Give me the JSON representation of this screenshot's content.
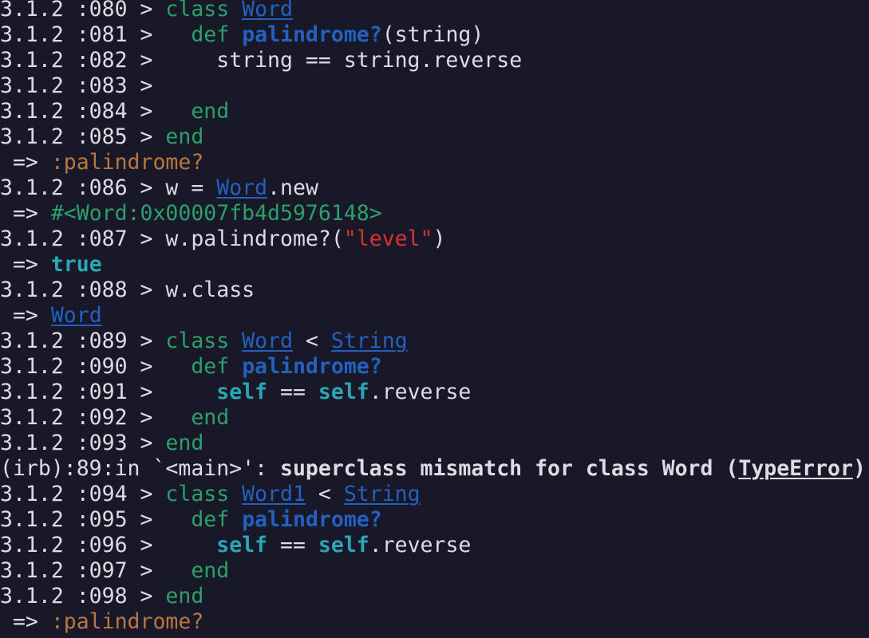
{
  "terminal": {
    "lines": [
      {
        "type": "input",
        "prompt": "3.1.2 :080 > ",
        "segs": [
          [
            "class",
            "kw"
          ],
          [
            " ",
            ""
          ],
          [
            "Word",
            "cn"
          ]
        ]
      },
      {
        "type": "input",
        "prompt": "3.1.2 :081 > ",
        "segs": [
          [
            "  ",
            ""
          ],
          [
            "def",
            "kw"
          ],
          [
            " ",
            ""
          ],
          [
            "palindrome?",
            "fn"
          ],
          [
            "(string)",
            ""
          ]
        ]
      },
      {
        "type": "input",
        "prompt": "3.1.2 :082 > ",
        "segs": [
          [
            "    string == string.reverse",
            ""
          ]
        ]
      },
      {
        "type": "input",
        "prompt": "3.1.2 :083 > ",
        "segs": []
      },
      {
        "type": "input",
        "prompt": "3.1.2 :084 > ",
        "segs": [
          [
            "  ",
            ""
          ],
          [
            "end",
            "kw"
          ]
        ]
      },
      {
        "type": "input",
        "prompt": "3.1.2 :085 > ",
        "segs": [
          [
            "end",
            "kw"
          ]
        ]
      },
      {
        "type": "output",
        "prompt": " => ",
        "segs": [
          [
            ":palindrome?",
            "sym"
          ]
        ]
      },
      {
        "type": "input",
        "prompt": "3.1.2 :086 > ",
        "segs": [
          [
            "w = ",
            ""
          ],
          [
            "Word",
            "cn"
          ],
          [
            ".new",
            ""
          ]
        ]
      },
      {
        "type": "output",
        "prompt": " => ",
        "segs": [
          [
            "#<Word:0x00007fb4d5976148>",
            "obj"
          ]
        ]
      },
      {
        "type": "input",
        "prompt": "3.1.2 :087 > ",
        "segs": [
          [
            "w.palindrome?(",
            ""
          ],
          [
            "\"level\"",
            "str"
          ],
          [
            ")",
            ""
          ]
        ]
      },
      {
        "type": "output",
        "prompt": " => ",
        "segs": [
          [
            "true",
            "tru"
          ]
        ]
      },
      {
        "type": "input",
        "prompt": "3.1.2 :088 > ",
        "segs": [
          [
            "w.class",
            ""
          ]
        ]
      },
      {
        "type": "output",
        "prompt": " => ",
        "segs": [
          [
            "Word",
            "cn"
          ]
        ]
      },
      {
        "type": "input",
        "prompt": "3.1.2 :089 > ",
        "segs": [
          [
            "class",
            "kw"
          ],
          [
            " ",
            ""
          ],
          [
            "Word",
            "cn"
          ],
          [
            " < ",
            ""
          ],
          [
            "String",
            "cn"
          ]
        ]
      },
      {
        "type": "input",
        "prompt": "3.1.2 :090 > ",
        "segs": [
          [
            "  ",
            ""
          ],
          [
            "def",
            "kw"
          ],
          [
            " ",
            ""
          ],
          [
            "palindrome?",
            "fn"
          ]
        ]
      },
      {
        "type": "input",
        "prompt": "3.1.2 :091 > ",
        "segs": [
          [
            "    ",
            ""
          ],
          [
            "self",
            "slf"
          ],
          [
            " == ",
            ""
          ],
          [
            "self",
            "slf"
          ],
          [
            ".reverse",
            ""
          ]
        ]
      },
      {
        "type": "input",
        "prompt": "3.1.2 :092 > ",
        "segs": [
          [
            "  ",
            ""
          ],
          [
            "end",
            "kw"
          ]
        ]
      },
      {
        "type": "input",
        "prompt": "3.1.2 :093 > ",
        "segs": [
          [
            "end",
            "kw"
          ]
        ]
      },
      {
        "type": "error",
        "prompt": "",
        "segs": [
          [
            "(irb):89:in `<main>': ",
            ""
          ],
          [
            "superclass mismatch for class Word (",
            "bold"
          ],
          [
            "TypeError",
            "bold err"
          ],
          [
            ")",
            "bold"
          ]
        ]
      },
      {
        "type": "input",
        "prompt": "3.1.2 :094 > ",
        "segs": [
          [
            "class",
            "kw"
          ],
          [
            " ",
            ""
          ],
          [
            "Word1",
            "cn"
          ],
          [
            " < ",
            ""
          ],
          [
            "String",
            "cn"
          ]
        ]
      },
      {
        "type": "input",
        "prompt": "3.1.2 :095 > ",
        "segs": [
          [
            "  ",
            ""
          ],
          [
            "def",
            "kw"
          ],
          [
            " ",
            ""
          ],
          [
            "palindrome?",
            "fn"
          ]
        ]
      },
      {
        "type": "input",
        "prompt": "3.1.2 :096 > ",
        "segs": [
          [
            "    ",
            ""
          ],
          [
            "self",
            "slf"
          ],
          [
            " == ",
            ""
          ],
          [
            "self",
            "slf"
          ],
          [
            ".reverse",
            ""
          ]
        ]
      },
      {
        "type": "input",
        "prompt": "3.1.2 :097 > ",
        "segs": [
          [
            "  ",
            ""
          ],
          [
            "end",
            "kw"
          ]
        ]
      },
      {
        "type": "input",
        "prompt": "3.1.2 :098 > ",
        "segs": [
          [
            "end",
            "kw"
          ]
        ]
      },
      {
        "type": "output",
        "prompt": " => ",
        "segs": [
          [
            ":palindrome?",
            "sym"
          ]
        ]
      }
    ]
  },
  "colors": {
    "background": "#181828",
    "text": "#dcdce4",
    "keyword": "#2aa06a",
    "constant": "#2360c0",
    "symbol": "#b8773f",
    "string": "#d63236",
    "true_self": "#2aa6b6"
  }
}
